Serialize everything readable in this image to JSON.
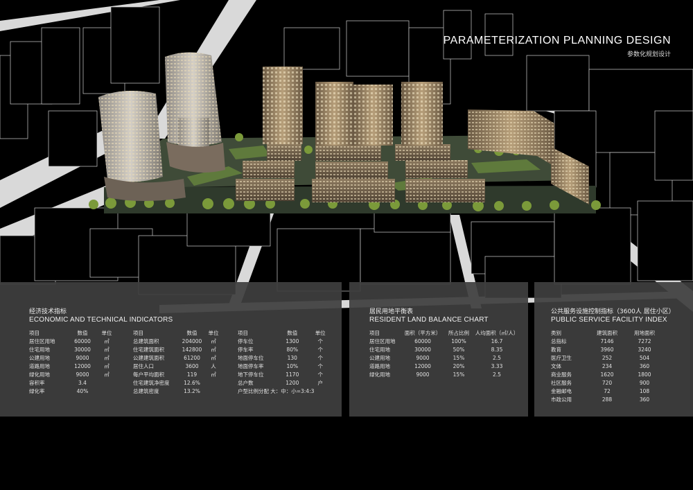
{
  "header": {
    "title_en": "PARAMETERIZATION PLANNING DESIGN",
    "title_cn": "参数化规划设计"
  },
  "economic": {
    "title_cn": "经济技术指标",
    "title_en": "ECONOMIC AND TECHNICAL INDICATORS",
    "table1": [
      [
        "项目",
        "数值",
        "单位"
      ],
      [
        "居住区用地",
        "60000",
        "㎡"
      ],
      [
        "住宅用地",
        "30000",
        "㎡"
      ],
      [
        "公建用地",
        "9000",
        "㎡"
      ],
      [
        "道路用地",
        "12000",
        "㎡"
      ],
      [
        "绿化用地",
        "9000",
        "㎡"
      ],
      [
        "容积率",
        "3.4",
        ""
      ],
      [
        "绿化率",
        "40%",
        ""
      ]
    ],
    "table2": [
      [
        "项目",
        "数值",
        "单位"
      ],
      [
        "总建筑面积",
        "204000",
        "㎡"
      ],
      [
        "住宅建筑面积",
        "142800",
        "㎡"
      ],
      [
        "公建建筑面积",
        "61200",
        "㎡"
      ],
      [
        "居住人口",
        "3600",
        "人"
      ],
      [
        "每户平均面积",
        "119",
        "㎡"
      ],
      [
        "住宅建筑净密度",
        "12.6%",
        ""
      ],
      [
        "总建筑密度",
        "13.2%",
        ""
      ]
    ],
    "table3": [
      [
        "项目",
        "数值",
        "单位"
      ],
      [
        "停车位",
        "1300",
        "个"
      ],
      [
        "停车率",
        "80%",
        "个"
      ],
      [
        "地面停车位",
        "130",
        "个"
      ],
      [
        "地面停车率",
        "10%",
        "个"
      ],
      [
        "地下停车位",
        "1170",
        "个"
      ],
      [
        "总户数",
        "1200",
        "户"
      ],
      [
        "户型比例分配",
        "大：中：小=3:4:3",
        ""
      ]
    ]
  },
  "land": {
    "title_cn": "居民用地平衡表",
    "title_en": "RESIDENT LAND BALANCE CHART",
    "table": [
      [
        "项目",
        "面积（平方米）",
        "所占比例",
        "人均面积（㎡/人）"
      ],
      [
        "居住区用地",
        "60000",
        "100%",
        "16.7"
      ],
      [
        "住宅用地",
        "30000",
        "50%",
        "8.35"
      ],
      [
        "公建用地",
        "9000",
        "15%",
        "2.5"
      ],
      [
        "道路用地",
        "12000",
        "20%",
        "3.33"
      ],
      [
        "绿化用地",
        "9000",
        "15%",
        "2.5"
      ]
    ]
  },
  "public": {
    "title_cn": "公共服务设施控制指标（3600人 居住小区）",
    "title_en": "PUBLIC SERVICE FACILITY INDEX",
    "table": [
      [
        "类别",
        "建筑面积",
        "用地面积"
      ],
      [
        "总指标",
        "7146",
        "7272"
      ],
      [
        "教育",
        "3960",
        "3240"
      ],
      [
        "医疗卫生",
        "252",
        "504"
      ],
      [
        "文体",
        "234",
        "360"
      ],
      [
        "商业服务",
        "1620",
        "1800"
      ],
      [
        "社区服务",
        "720",
        "900"
      ],
      [
        "金融邮电",
        "72",
        "108"
      ],
      [
        "市政公用",
        "288",
        "360"
      ]
    ]
  }
}
